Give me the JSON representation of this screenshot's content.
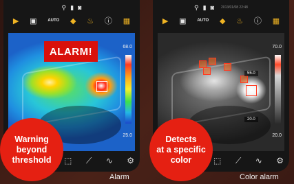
{
  "panels": [
    {
      "caption": "Alarm",
      "badge_lines": [
        "Warning",
        "beyond",
        "threshold"
      ],
      "alarm_label": "ALARM!",
      "scale_max": "68.0",
      "scale_min": "25.0",
      "toolbar": {
        "auto_label": "AUTO"
      },
      "palette": "iron-rainbow"
    },
    {
      "caption": "Color alarm",
      "badge_lines": [
        "Detects",
        "at a specific",
        "color"
      ],
      "timestamp": "2013/01/08 22:48",
      "scale_max": "70.0",
      "scale_min": "20.0",
      "inner_high": "55.0",
      "inner_low": "20.0",
      "toolbar": {
        "auto_label": "AUTO"
      },
      "palette": "grayscale-with-red-highlight"
    }
  ],
  "icons": {
    "status": [
      "usb-icon",
      "battery-icon",
      "camera-icon"
    ],
    "toolbar": [
      "video-record-icon",
      "gallery-icon",
      "auto-label",
      "alarm-bell-icon",
      "hotspot-icon",
      "info-icon",
      "palette-icon"
    ],
    "bottom": [
      "area-select-icon",
      "line-measure-icon",
      "graph-icon",
      "settings-icon"
    ]
  },
  "colors": {
    "accent_red": "#e52012",
    "toolbar_yellow": "#f0b423",
    "background": "#3a1a14"
  }
}
